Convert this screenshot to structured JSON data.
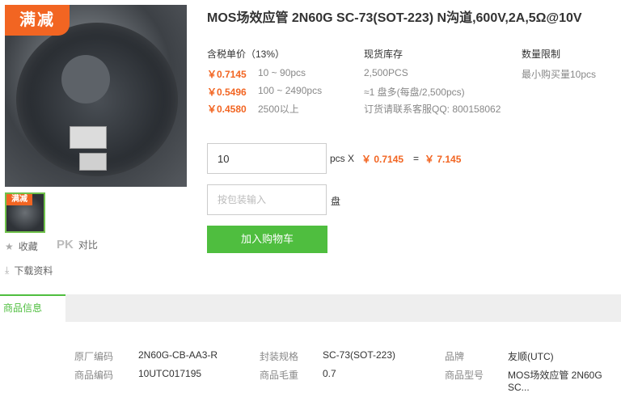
{
  "product": {
    "badge": "满减",
    "thumb_badge": "满减",
    "title": "MOS场效应管 2N60G SC-73(SOT-223) N沟道,600V,2A,5Ω@10V"
  },
  "actions": {
    "favorite": "收藏",
    "pk": "PK",
    "compare": "对比",
    "download": "下载资料"
  },
  "pricing": {
    "header": "含税单价（13%）",
    "tiers": [
      {
        "price": "￥0.7145",
        "range": "10 ~ 90pcs"
      },
      {
        "price": "￥0.5496",
        "range": "100 ~ 2490pcs"
      },
      {
        "price": "￥0.4580",
        "range": "2500以上"
      }
    ]
  },
  "stock": {
    "header": "现货库存",
    "amount": "2,500PCS",
    "reel": "≈1 盘多(每盘/2,500pcs)",
    "contact": "订货请联系客服QQ: 800158062"
  },
  "limit": {
    "header": "数量限制",
    "min": "最小购买量10pcs"
  },
  "order": {
    "qty_value": "10",
    "unit": "pcs X",
    "unit_price": "￥ 0.7145",
    "equals": "=",
    "total": "￥ 7.145",
    "pkg_placeholder": "按包装输入",
    "pkg_unit": "盘",
    "cart_label": "加入购物车"
  },
  "tabs": {
    "info": "商品信息"
  },
  "specs": {
    "row1": [
      {
        "label": "原厂编码",
        "value": "2N60G-CB-AA3-R"
      },
      {
        "label": "封装规格",
        "value": "SC-73(SOT-223)"
      },
      {
        "label": "品牌",
        "value": "友顺(UTC)"
      }
    ],
    "row2": [
      {
        "label": "商品编码",
        "value": "10UTC017195"
      },
      {
        "label": "商品毛重",
        "value": "0.7"
      },
      {
        "label": "商品型号",
        "value": "MOS场效应管 2N60G SC..."
      }
    ]
  },
  "colors": {
    "accent": "#f26522",
    "green": "#4fbe3f"
  }
}
